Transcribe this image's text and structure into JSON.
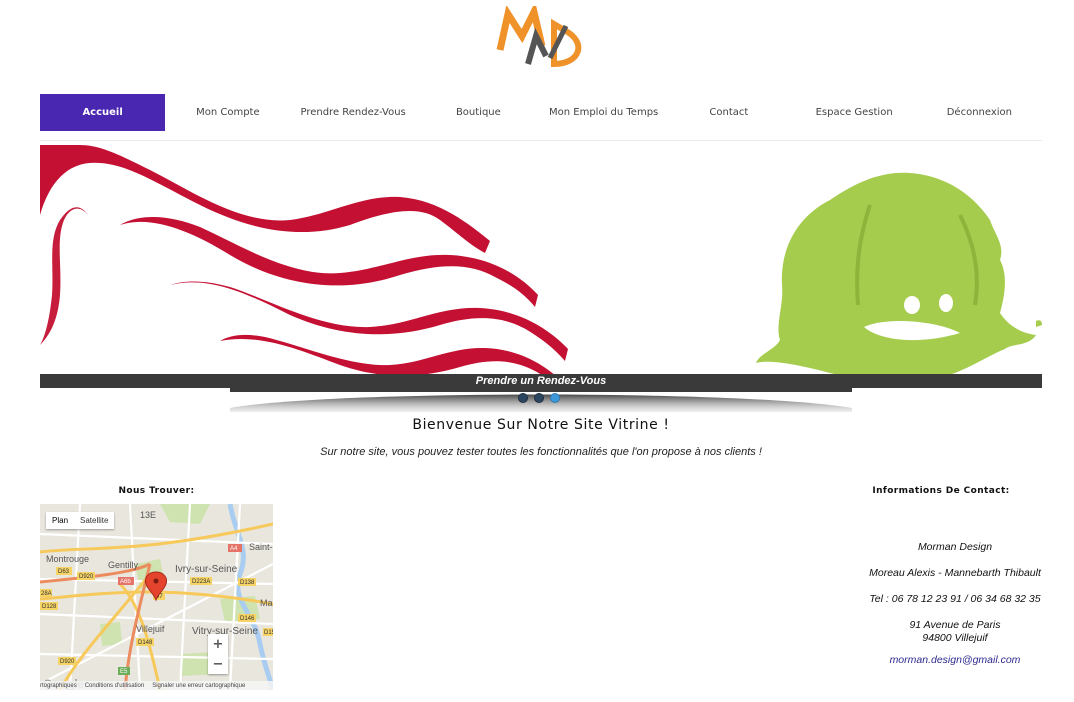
{
  "logo": {
    "text": "MAD",
    "colors": [
      "#f0922a",
      "#555555"
    ]
  },
  "nav": {
    "items": [
      {
        "label": "Accueil",
        "active": true
      },
      {
        "label": "Mon Compte"
      },
      {
        "label": "Prendre Rendez-Vous"
      },
      {
        "label": "Boutique"
      },
      {
        "label": "Mon Emploi du Temps"
      },
      {
        "label": "Contact"
      },
      {
        "label": "Espace Gestion"
      },
      {
        "label": "Déconnexion"
      }
    ],
    "active_color": "#4a27b0"
  },
  "slider": {
    "caption": "Prendre un Rendez-Vous",
    "slide_count": 3,
    "active_slide": 3,
    "colors": {
      "waves": "#c41133",
      "mascot": "#a6cc4e"
    }
  },
  "welcome": {
    "title": "Bienvenue Sur Notre Site Vitrine !",
    "subtitle": "Sur notre site, vous pouvez tester toutes les fonctionnalités que l'on propose à nos clients !"
  },
  "find_us": {
    "title": "Nous Trouver:",
    "map": {
      "toggle": [
        "Plan",
        "Satellite"
      ],
      "selected": "Plan",
      "places": [
        "13E",
        "Montrouge",
        "Gentilly",
        "Ivry-sur-Seine",
        "Villejuif",
        "Vitry-sur-Seine",
        "Saint-M",
        "Mais"
      ],
      "roads": [
        "D63",
        "D920",
        "A6b",
        "D223A",
        "D138",
        "D128",
        "D148",
        "D146",
        "D5",
        "D920",
        "E5",
        "A4",
        "D7",
        "28A",
        "D15"
      ],
      "footer": [
        "rtographiques",
        "Conditions d'utilisation",
        "Signaler une erreur cartographique"
      ],
      "watermark": "Google",
      "zoom_in": "+",
      "zoom_out": "−"
    }
  },
  "contact": {
    "title": "Informations De Contact:",
    "company": "Morman Design",
    "names": "Moreau Alexis - Mannebarth Thibault",
    "phone": "Tel : 06 78 12 23 91 / 06 34 68 32 35",
    "address_line1": "91 Avenue de Paris",
    "address_line2": "94800 Villejuif",
    "email": "morman.design@gmail.com"
  }
}
